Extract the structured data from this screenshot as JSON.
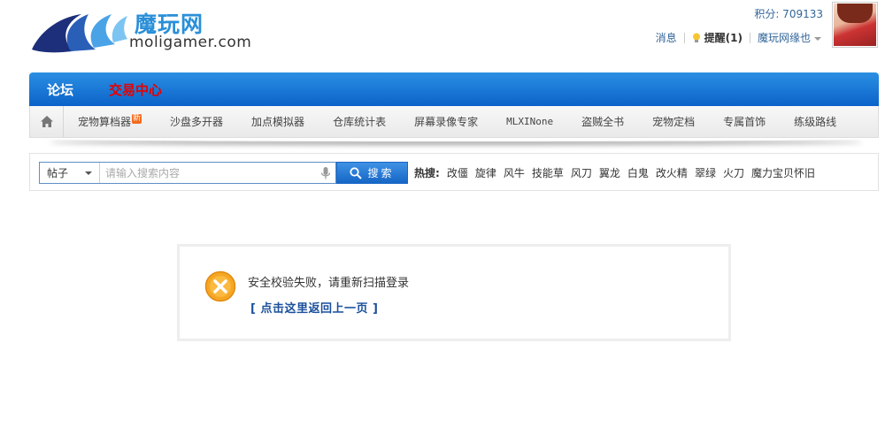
{
  "site": {
    "logo_cn": "魔玩网",
    "logo_en": "moligamer.com"
  },
  "header": {
    "points_label": "积分: 709133",
    "messages_label": "消息",
    "remind_label": "提醒(1)",
    "user_label": "魔玩网缘也"
  },
  "nav": {
    "forum_label": "论坛",
    "trade_label": "交易中心"
  },
  "subnav": {
    "items": [
      {
        "label": "宠物算档器",
        "badge": "新"
      },
      {
        "label": "沙盘多开器"
      },
      {
        "label": "加点模拟器"
      },
      {
        "label": "仓库统计表"
      },
      {
        "label": "屏幕录像专家"
      },
      {
        "label": "MLXINone"
      },
      {
        "label": "盗贼全书"
      },
      {
        "label": "宠物定档"
      },
      {
        "label": "专属首饰"
      },
      {
        "label": "练级路线"
      }
    ]
  },
  "search": {
    "type_label": "帖子",
    "placeholder": "请输入搜索内容",
    "button_label": "搜索",
    "hot_label": "热搜:",
    "hot_items": [
      "改僵",
      "旋律",
      "风牛",
      "技能草",
      "风刀",
      "翼龙",
      "白鬼",
      "改火精",
      "翠绿",
      "火刀",
      "魔力宝贝怀旧"
    ]
  },
  "message": {
    "text": "安全校验失败，请重新扫描登录",
    "link": "[ 点击这里返回上一页 ]"
  },
  "colors": {
    "nav_blue": "#0b63c9",
    "trade_red": "#e60000",
    "link_blue": "#1a4f9c",
    "error_orange": "#f39a1e"
  }
}
